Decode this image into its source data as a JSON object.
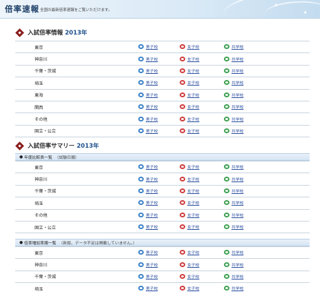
{
  "header": {
    "title": "倍率速報",
    "subtitle": "全国の最新倍率速報をご覧いただけます。"
  },
  "link_labels": {
    "boys": "男子校",
    "girls": "女子校",
    "coed": "共学校"
  },
  "section1": {
    "title": "入試倍率情報",
    "year": "2013年",
    "regions": [
      "東京",
      "神奈川",
      "千葉・茨城",
      "埼玉",
      "東海",
      "関西",
      "その他",
      "国立・公立"
    ]
  },
  "section2": {
    "title": "入試倍率サマリー",
    "year": "2013年",
    "sub1": {
      "label": "年度比較表一覧",
      "note": "（試験日順）",
      "regions": [
        "東京",
        "神奈川",
        "千葉・茨城",
        "埼玉",
        "その他",
        "国立・公立"
      ]
    },
    "sub2": {
      "label": "倍率増加率順一覧",
      "note": "（新設、データ不足は掲載していません。）",
      "regions": [
        "東京",
        "神奈川",
        "千葉・茨城",
        "埼玉"
      ]
    }
  },
  "colors": {
    "title": "#1c3e66",
    "year": "#1d4f8c",
    "diamond": "#8b1e1e",
    "link": "#2a4fa0"
  }
}
